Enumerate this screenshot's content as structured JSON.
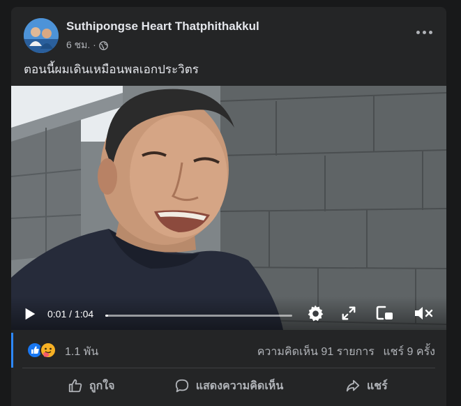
{
  "post": {
    "author": "Suthipongse Heart Thatphithakkul",
    "time": "6 ชม. ·",
    "privacy_icon": "globe-icon",
    "text": "ตอนนี้ผมเดินเหมือนพลเอกประวิตร"
  },
  "video": {
    "current_time": "0:01",
    "duration": "1:04",
    "time_display": "0:01 / 1:04",
    "progress_fraction": 0.016
  },
  "reactions": {
    "count": "1.1 พัน",
    "comments": "ความคิดเห็น 91 รายการ",
    "shares": "แชร์ 9 ครั้ง",
    "icons": [
      "like-reaction-icon",
      "care-reaction-icon"
    ]
  },
  "actions": {
    "like": "ถูกใจ",
    "comment": "แสดงความคิดเห็น",
    "share": "แชร์"
  },
  "colors": {
    "background": "#18191a",
    "card": "#242526",
    "text_primary": "#e4e6eb",
    "text_secondary": "#b0b3b8",
    "accent": "#2d88ff"
  }
}
